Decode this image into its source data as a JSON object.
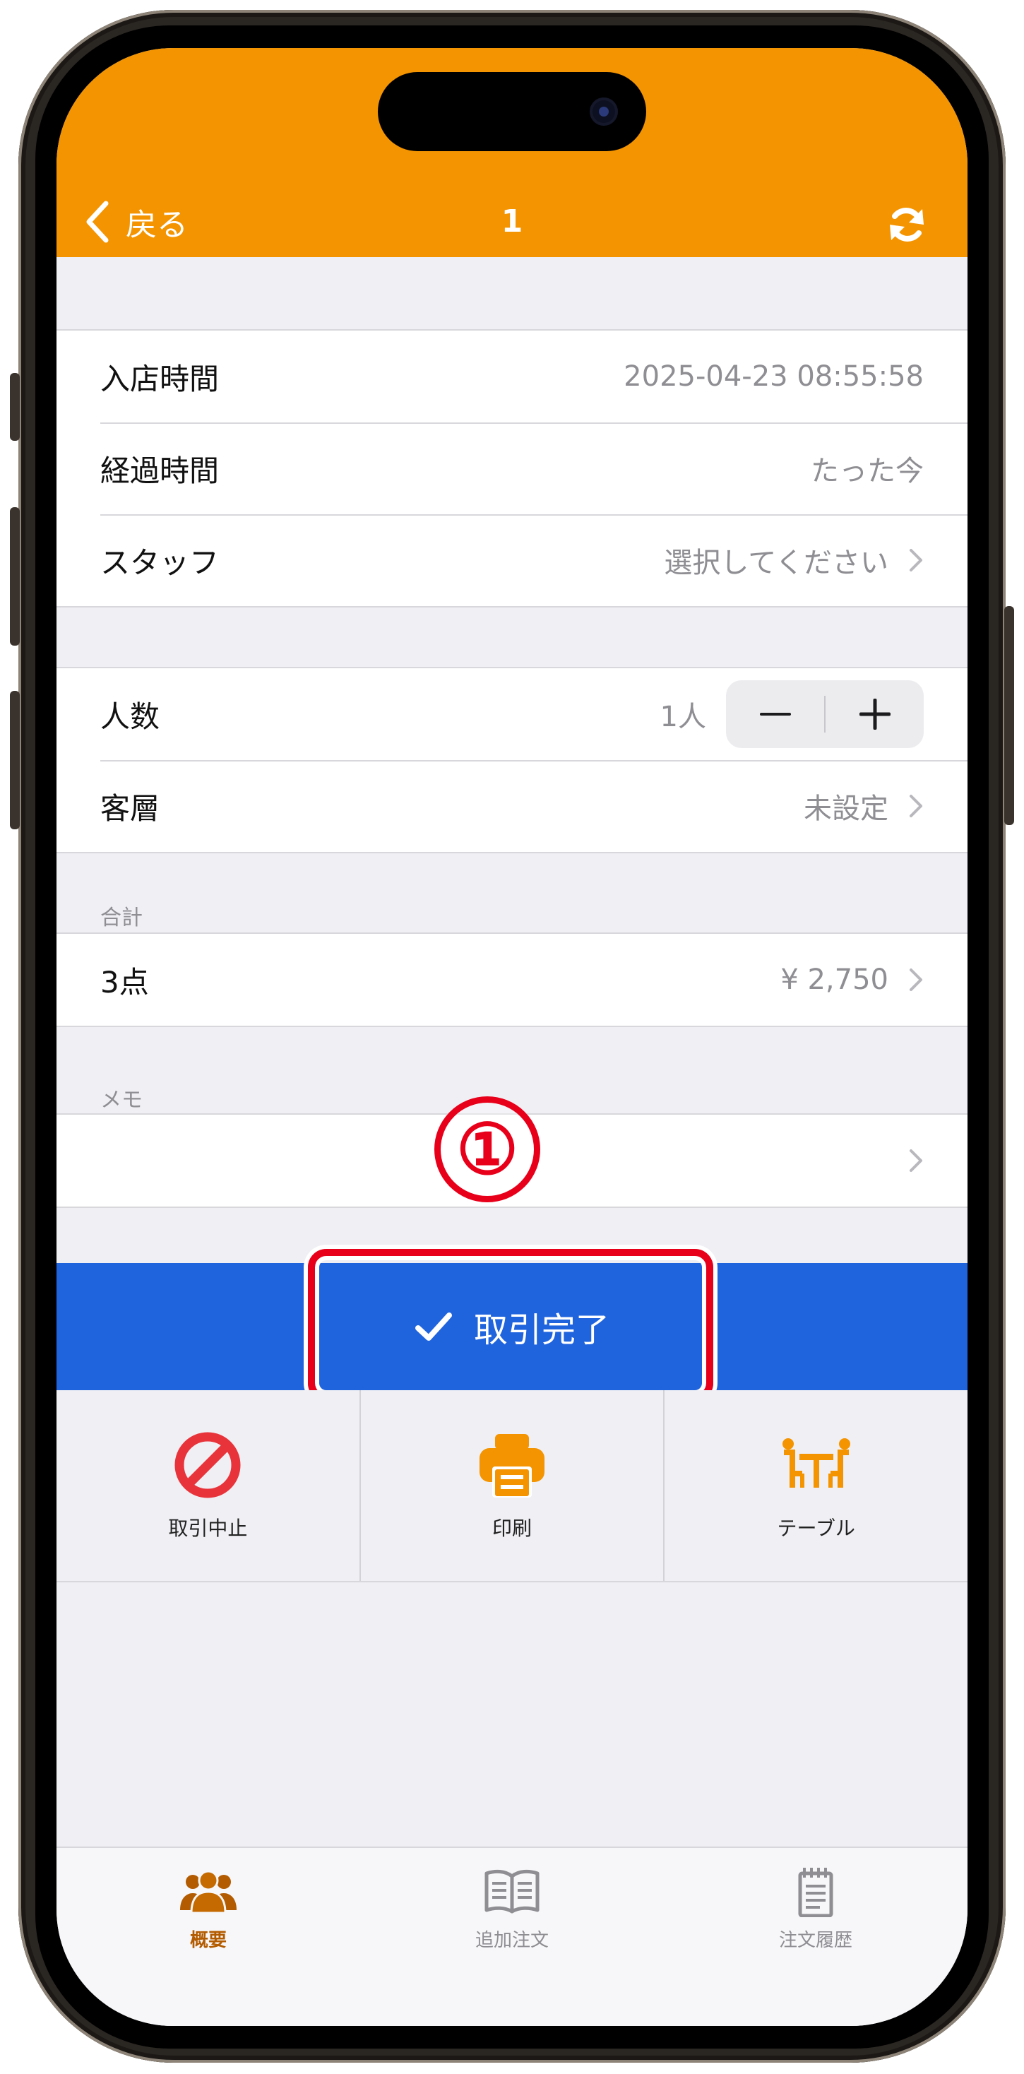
{
  "colors": {
    "header": "#f49400",
    "primary_button": "#2064dd",
    "highlight": "#e8001a",
    "active_tab": "#b35b00",
    "cancel_icon": "#e8333a",
    "print_icon": "#f49400"
  },
  "header": {
    "back_label": "戻る",
    "title": "1",
    "refresh_icon": "refresh-icon"
  },
  "info": {
    "entry_time_label": "入店時間",
    "entry_time_value": "2025-04-23 08:55:58",
    "elapsed_label": "経過時間",
    "elapsed_value": "たった今",
    "staff_label": "スタッフ",
    "staff_value": "選択してください"
  },
  "guests": {
    "count_label": "人数",
    "count_value": "1人",
    "minus": "−",
    "plus": "+",
    "segment_label": "客層",
    "segment_value": "未設定"
  },
  "total": {
    "section": "合計",
    "items": "3点",
    "amount": "¥ 2,750"
  },
  "memo": {
    "section": "メモ"
  },
  "annotation": {
    "number": "①"
  },
  "complete_button": {
    "label": "取引完了"
  },
  "actions": [
    {
      "label": "取引中止",
      "icon": "prohibit-icon"
    },
    {
      "label": "印刷",
      "icon": "printer-icon"
    },
    {
      "label": "テーブル",
      "icon": "table-icon"
    }
  ],
  "tabs": [
    {
      "label": "概要",
      "icon": "people-icon",
      "active": true
    },
    {
      "label": "追加注文",
      "icon": "menu-book-icon",
      "active": false
    },
    {
      "label": "注文履歴",
      "icon": "notepad-icon",
      "active": false
    }
  ]
}
